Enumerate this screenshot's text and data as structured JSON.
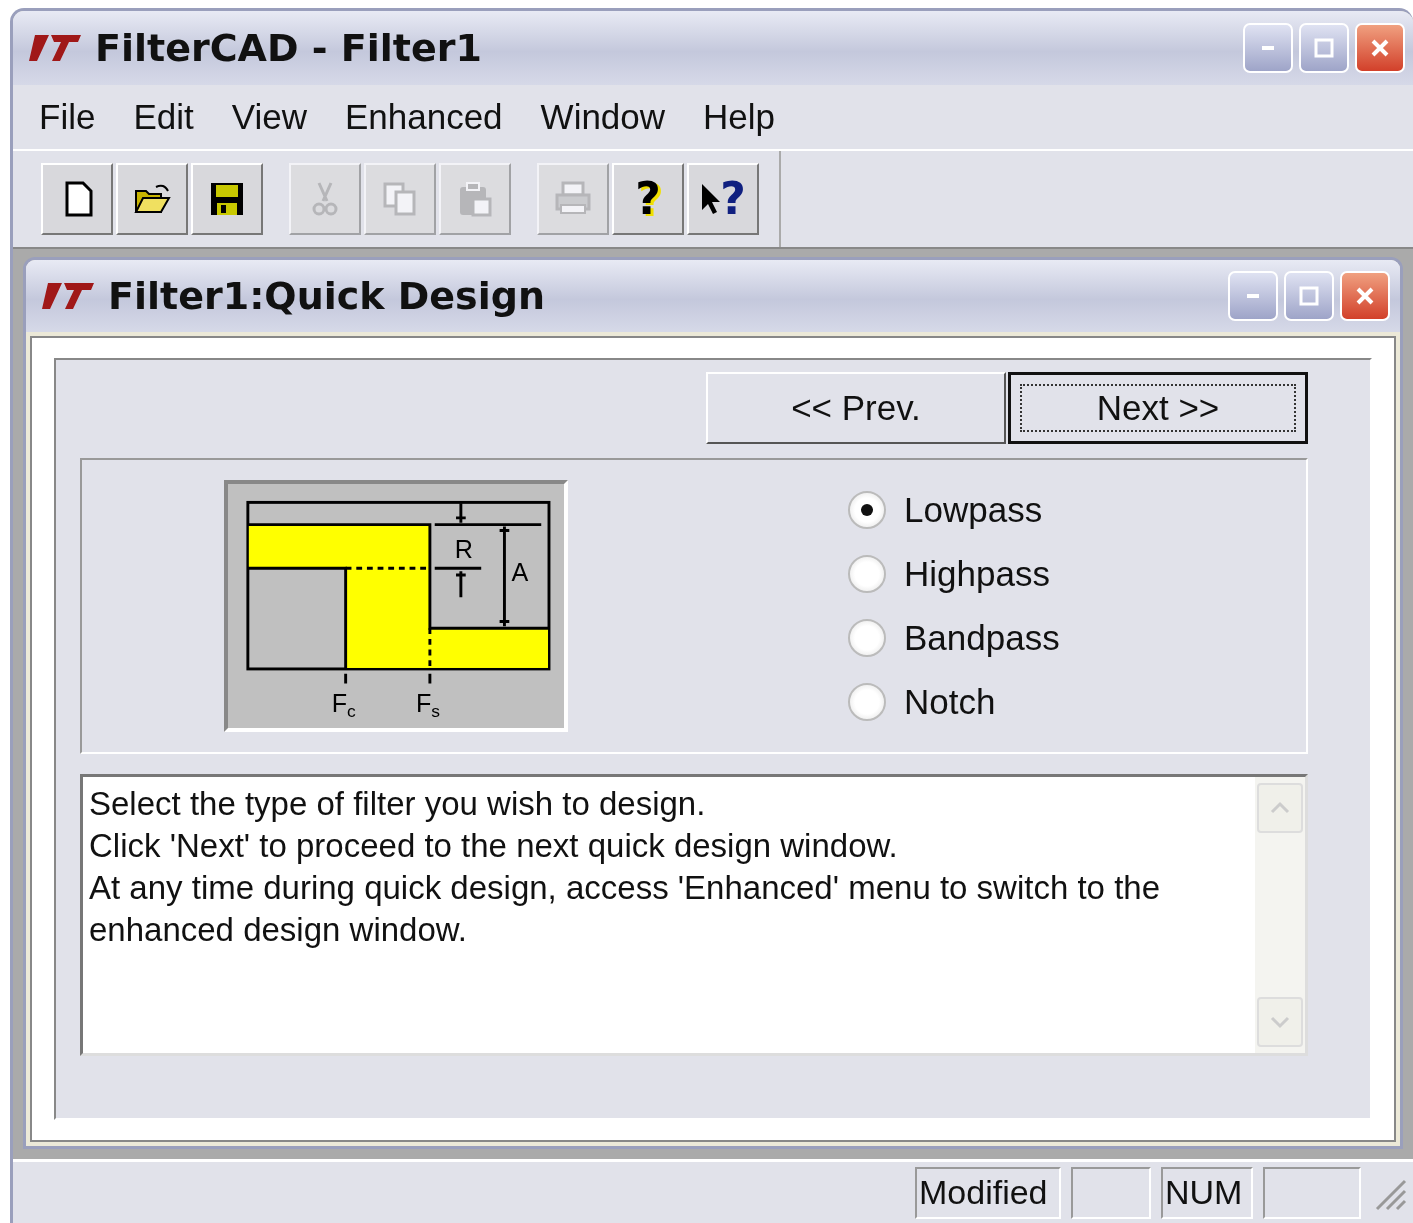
{
  "window": {
    "title": "FilterCAD - Filter1"
  },
  "menu": [
    {
      "label": "File"
    },
    {
      "label": "Edit"
    },
    {
      "label": "View"
    },
    {
      "label": "Enhanced"
    },
    {
      "label": "Window"
    },
    {
      "label": "Help"
    }
  ],
  "toolbar_groups": [
    {
      "buttons": [
        {
          "kind": "new",
          "disabled": false
        },
        {
          "kind": "open",
          "disabled": false
        },
        {
          "kind": "save",
          "disabled": false
        }
      ]
    },
    {
      "buttons": [
        {
          "kind": "cut",
          "disabled": true
        },
        {
          "kind": "copy",
          "disabled": true
        },
        {
          "kind": "paste",
          "disabled": true
        }
      ]
    },
    {
      "buttons": [
        {
          "kind": "print",
          "disabled": true
        },
        {
          "kind": "help",
          "disabled": false,
          "glyph": "?"
        },
        {
          "kind": "context_help",
          "disabled": false,
          "glyph": "?"
        }
      ]
    }
  ],
  "child_window": {
    "title": "Filter1:Quick Design",
    "buttons": [
      {
        "label": "<< Prev.",
        "focused": false
      },
      {
        "label": "Next >>",
        "focused": true
      }
    ],
    "diagram": {
      "labels": [
        {
          "kind": "R",
          "text": "R"
        },
        {
          "kind": "A",
          "text": "A"
        },
        {
          "kind": "Fc",
          "text": "F$_{c}$"
        },
        {
          "kind": "Fs",
          "text": "F$_{s}$"
        }
      ]
    },
    "filter_types": [
      {
        "label": "Lowpass",
        "selected": true
      },
      {
        "label": "Highpass",
        "selected": false
      },
      {
        "label": "Bandpass",
        "selected": false
      },
      {
        "label": "Notch",
        "selected": false
      }
    ],
    "description": [
      "Select the type of filter you wish to design.",
      "Click 'Next' to proceed to the next quick design window.",
      "At any time during quick design, access 'Enhanced' menu to switch to the enhanced design window."
    ]
  },
  "status_bar": {
    "panes": [
      {
        "kind": "text",
        "text": "Modified"
      },
      {
        "kind": "empty"
      },
      {
        "kind": "text",
        "text": "NUM"
      },
      {
        "kind": "empty"
      }
    ]
  }
}
